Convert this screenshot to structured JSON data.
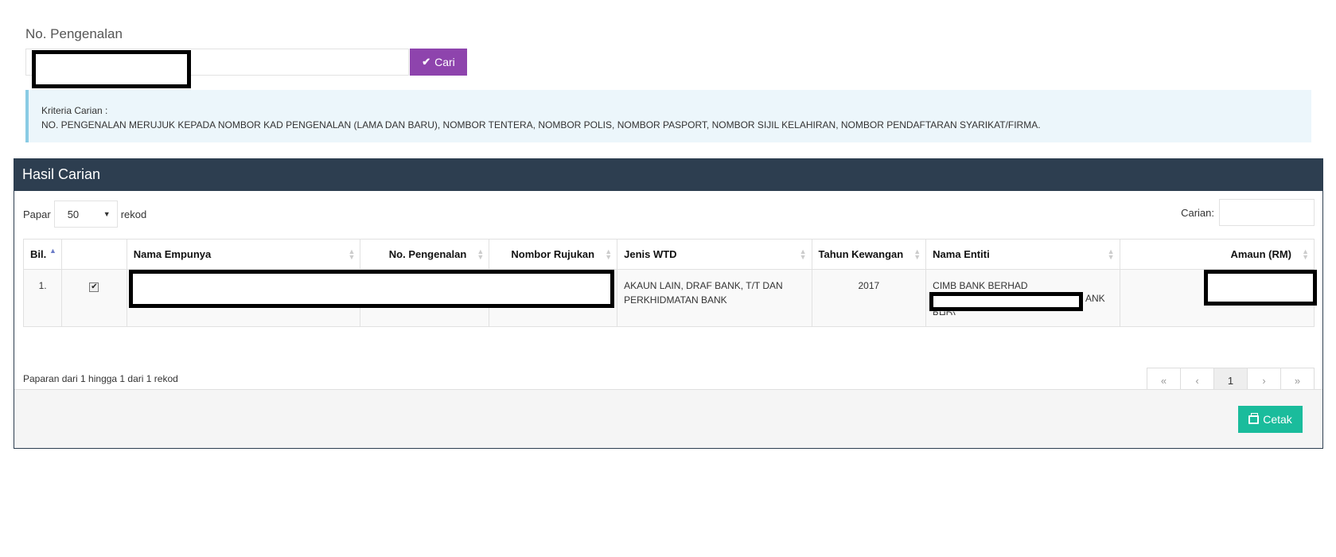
{
  "search": {
    "label": "No. Pengenalan",
    "input_value": "",
    "button_label": "Cari",
    "button_icon": "check-icon"
  },
  "criteria": {
    "title": "Kriteria Carian :",
    "text": "NO. PENGENALAN MERUJUK KEPADA NOMBOR KAD PENGENALAN (LAMA DAN BARU), NOMBOR TENTERA, NOMBOR POLIS, NOMBOR PASPORT, NOMBOR SIJIL KELAHIRAN, NOMBOR PENDAFTARAN SYARIKAT/FIRMA."
  },
  "panel": {
    "title": "Hasil Carian",
    "length_prefix": "Papar",
    "length_value": "50",
    "length_suffix": "rekod",
    "filter_label": "Carian:",
    "filter_value": ""
  },
  "table": {
    "headers": [
      "Bil.",
      "",
      "Nama Empunya",
      "No. Pengenalan",
      "Nombor Rujukan",
      "Jenis WTD",
      "Tahun Kewangan",
      "Nama Entiti",
      "Amaun (RM)"
    ],
    "rows": [
      {
        "bil": "1.",
        "checked": true,
        "nama_empunya": "",
        "no_pengenalan": "",
        "nombor_rujukan": "",
        "jenis_wtd": "AKAUN LAIN, DRAF BANK, T/T DAN PERKHIDMATAN BANK",
        "tahun_kewangan": "2017",
        "nama_entiti": "CIMB BANK BERHAD",
        "nama_entiti_fragment": "ANK",
        "nama_entiti_fragment2": "BHD)",
        "amaun": ""
      }
    ]
  },
  "info": "Paparan dari 1 hingga 1 dari 1 rekod",
  "pagination": {
    "first": "«",
    "prev": "‹",
    "current": "1",
    "next": "›",
    "last": "»"
  },
  "footer": {
    "print_label": "Cetak",
    "print_icon": "print-icon"
  },
  "colors": {
    "cari_button": "#8e44ad",
    "cetak_button": "#1abc9c",
    "panel_heading": "#2d3e50",
    "info_box": "#ecf6fb"
  }
}
